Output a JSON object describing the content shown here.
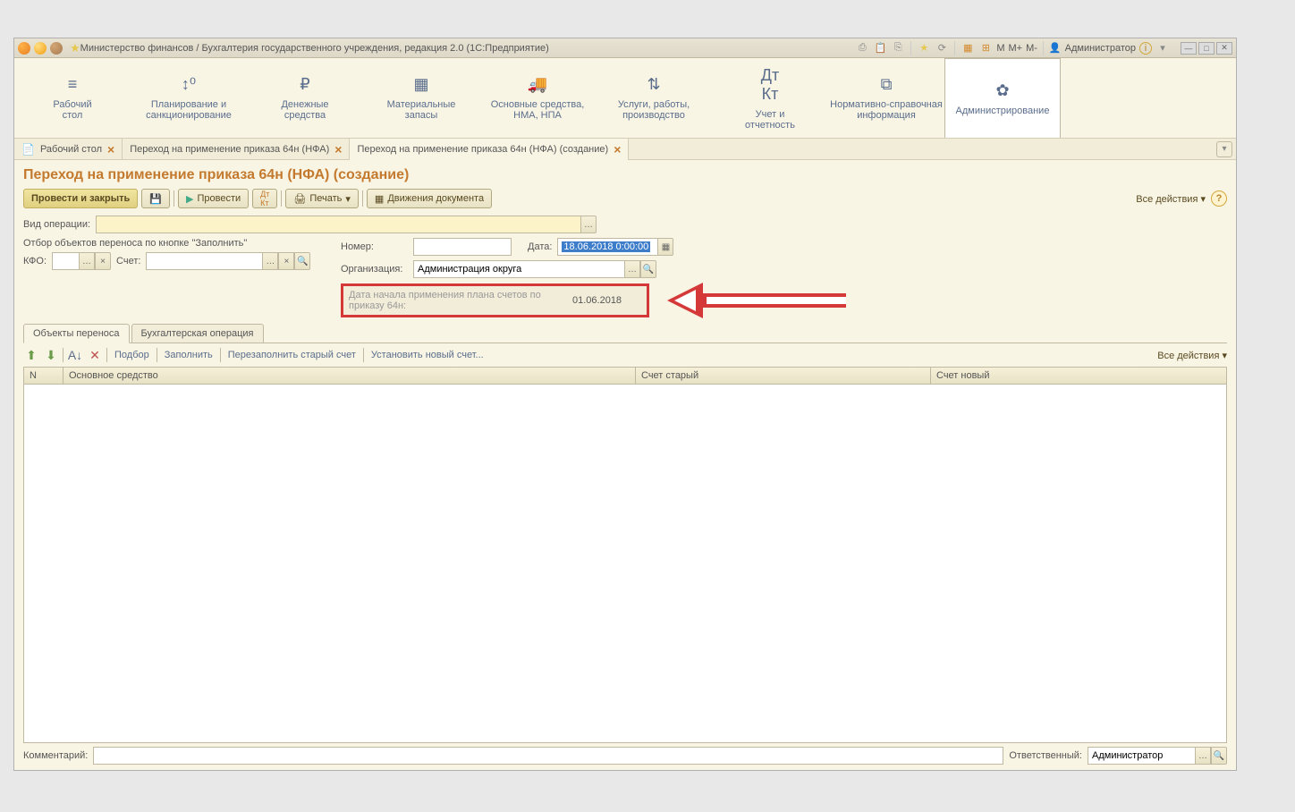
{
  "titlebar": {
    "text": "Министерство финансов / Бухгалтерия государственного учреждения, редакция 2.0  (1С:Предприятие)",
    "m_labels": [
      "M",
      "M+",
      "M-"
    ],
    "user": "Администратор"
  },
  "mainnav": {
    "items": [
      {
        "label": "Рабочий\nстол",
        "icon": "≡"
      },
      {
        "label": "Планирование и\nсанкционирование",
        "icon": "↕⁰"
      },
      {
        "label": "Денежные\nсредства",
        "icon": "₽"
      },
      {
        "label": "Материальные\nзапасы",
        "icon": "▦"
      },
      {
        "label": "Основные средства,\nНМА, НПА",
        "icon": "⛟"
      },
      {
        "label": "Услуги, работы,\nпроизводство",
        "icon": "⇅"
      },
      {
        "label": "Учет и\nотчетность",
        "icon": "ᴬₖ"
      },
      {
        "label": "Нормативно-справочная\nинформация",
        "icon": "⧉"
      },
      {
        "label": "Администрирование",
        "icon": "✿"
      }
    ]
  },
  "tabs": {
    "items": [
      "Рабочий стол",
      "Переход на применение приказа 64н (НФА)",
      "Переход на применение приказа 64н (НФА) (создание)"
    ]
  },
  "doc": {
    "title": "Переход на применение приказа 64н (НФА) (создание)",
    "toolbar": {
      "post_close": "Провести и закрыть",
      "post": "Провести",
      "print": "Печать",
      "movements": "Движения документа",
      "all_actions": "Все действия"
    },
    "form": {
      "op_type_label": "Вид операции:",
      "filter_label": "Отбор объектов переноса по кнопке \"Заполнить\"",
      "kfo_label": "КФО:",
      "account_label": "Счет:",
      "number_label": "Номер:",
      "date_label": "Дата:",
      "date_value": "18.06.2018  0:00:00",
      "org_label": "Организация:",
      "org_value": "Администрация округа",
      "plan_date_label": "Дата начала применения плана счетов по приказу 64н:",
      "plan_date_value": "01.06.2018"
    },
    "subtabs": {
      "objects": "Объекты переноса",
      "accounting": "Бухгалтерская операция"
    },
    "tabletoolbar": {
      "pick": "Подбор",
      "fill": "Заполнить",
      "refill": "Перезаполнить старый счет",
      "set_new": "Установить новый счет...",
      "all_actions": "Все действия"
    },
    "table": {
      "col_n": "N",
      "col_main": "Основное средство",
      "col_old": "Счет старый",
      "col_new": "Счет новый"
    },
    "footer": {
      "comment_label": "Комментарий:",
      "responsible_label": "Ответственный:",
      "responsible_value": "Администратор"
    }
  }
}
